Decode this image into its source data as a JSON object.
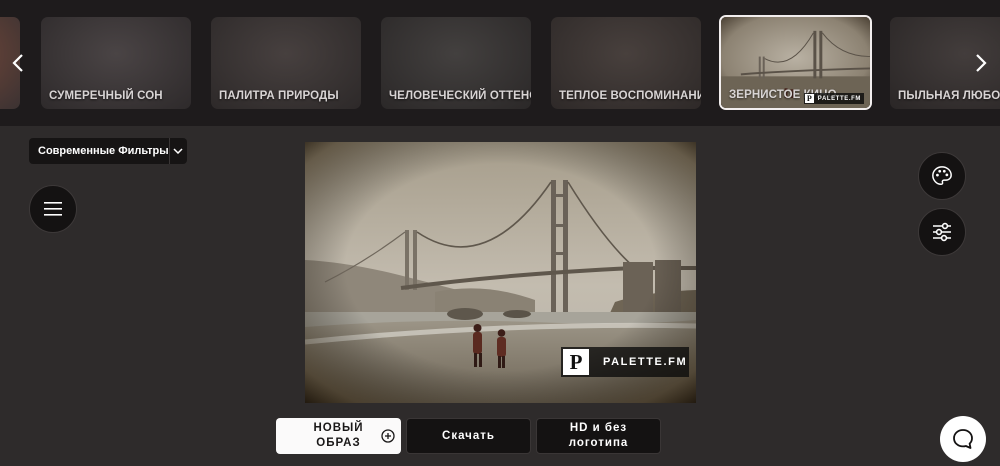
{
  "filters": [
    {
      "label": "",
      "colors": [
        "#7a4a3a",
        "#3b3232"
      ]
    },
    {
      "label": "СУМЕРЕЧНЫЙ СОН",
      "colors": [
        "#4a4445",
        "#2e2a2b"
      ]
    },
    {
      "label": "ПАЛИТРА ПРИРОДЫ",
      "colors": [
        "#47403f",
        "#2d2929"
      ]
    },
    {
      "label": "ЧЕЛОВЕЧЕСКИЙ ОТТЕНОК",
      "colors": [
        "#43403f",
        "#2b2828"
      ]
    },
    {
      "label": "ТЕПЛОЕ ВОСПОМИНАНИЕ",
      "colors": [
        "#48403d",
        "#2e2928"
      ]
    },
    {
      "label": "ЗЕРНИСТОЕ КИНО",
      "colors": [
        "#8a8072",
        "#4b4539"
      ]
    },
    {
      "label": "ПЫЛЬНАЯ ЛЮБОВЬ",
      "colors": [
        "#433d3c",
        "#2a2626"
      ]
    }
  ],
  "active_filter": "ЗЕРНИСТОЕ КИНО",
  "nav": {
    "prev_icon": "chevron-left-icon",
    "next_icon": "chevron-right-icon"
  },
  "dropdown": {
    "label": "Современные Фильтры",
    "icon": "chevron-down-icon"
  },
  "photo": {
    "watermark_letter": "P",
    "watermark_text": "PALETTE.FM"
  },
  "buttons": {
    "new_look": "НОВЫЙ ОБРАЗ",
    "download": "Скачать",
    "hd": "HD и без логотипа"
  },
  "thumb_watermark": "PALETTE.FM",
  "icons": {
    "menu": "menu-icon",
    "palette": "palette-icon",
    "adjust": "sliders-icon",
    "chat": "chat-icon",
    "add": "plus-circle-icon"
  },
  "colors": {
    "background": "#2e2b2b",
    "strip": "#1e1b1c",
    "button_dark": "#141212",
    "button_light": "#fbfafa"
  }
}
